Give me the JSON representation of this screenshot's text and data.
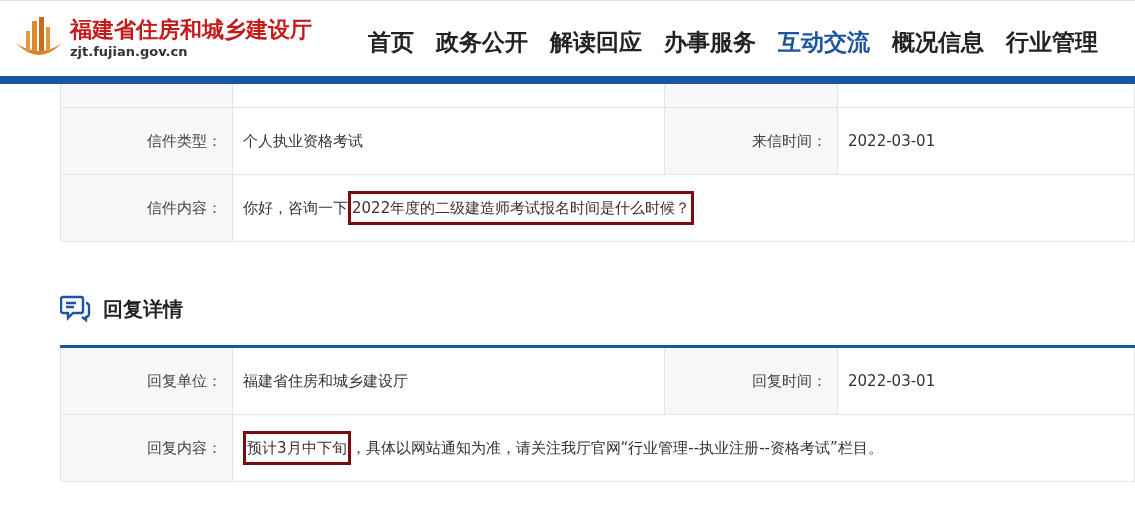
{
  "header": {
    "site_title": "福建省住房和城乡建设厅",
    "site_domain": "zjt.fujian.gov.cn",
    "nav": [
      {
        "label": "首页",
        "selected": false
      },
      {
        "label": "政务公开",
        "selected": false
      },
      {
        "label": "解读回应",
        "selected": false
      },
      {
        "label": "办事服务",
        "selected": false
      },
      {
        "label": "互动交流",
        "selected": true
      },
      {
        "label": "概况信息",
        "selected": false
      },
      {
        "label": "行业管理",
        "selected": false
      }
    ]
  },
  "letter": {
    "rows": [
      {
        "cells": [
          {
            "label": "信件类型：",
            "value": [
              {
                "text": "个人执业资格考试",
                "highlighted": false
              }
            ]
          },
          {
            "label": "来信时间：",
            "value": [
              {
                "text": "2022-03-01",
                "highlighted": false
              }
            ]
          }
        ]
      },
      {
        "cells": [
          {
            "label": "信件内容：",
            "value": [
              {
                "text": "你好，咨询一下",
                "highlighted": false
              },
              {
                "text": "2022年度的二级建造师考试报名时间是什么时候？",
                "highlighted": true
              }
            ]
          }
        ]
      }
    ]
  },
  "reply": {
    "heading": "回复详情",
    "rows": [
      {
        "cells": [
          {
            "label": "回复单位：",
            "value": [
              {
                "text": "福建省住房和城乡建设厅",
                "highlighted": false
              }
            ]
          },
          {
            "label": "回复时间：",
            "value": [
              {
                "text": "2022-03-01",
                "highlighted": false
              }
            ]
          }
        ]
      },
      {
        "cells": [
          {
            "label": "回复内容：",
            "value": [
              {
                "text": "预计3月中下旬",
                "highlighted": true
              },
              {
                "text": "，具体以网站通知为准，请关注我厅官网“行业管理--执业注册--资格考试”栏目。",
                "highlighted": false
              }
            ]
          }
        ]
      }
    ]
  }
}
